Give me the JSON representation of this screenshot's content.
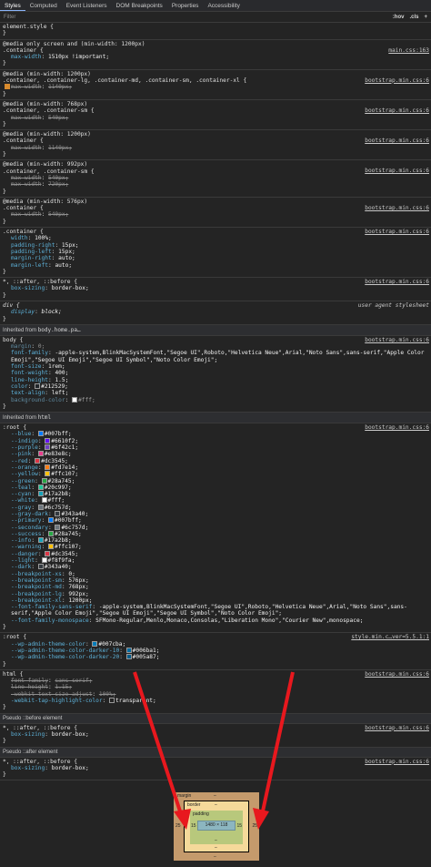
{
  "tabs": [
    "Styles",
    "Computed",
    "Event Listeners",
    "DOM Breakpoints",
    "Properties",
    "Accessibility"
  ],
  "filter": {
    "placeholder": "Filter",
    "hov": ":hov",
    "cls": ".cls",
    "add": "+"
  },
  "rules": [
    {
      "selector": "element.style {",
      "close": "}"
    },
    {
      "media": "@media only screen and (min-width: 1200px)",
      "selector": ".container {",
      "source": "main.css:163",
      "decls": [
        {
          "n": "max-width",
          "v": "1510px !important;"
        }
      ],
      "close": "}"
    },
    {
      "media": "@media (min-width: 1200px)",
      "selector": ".container, .container-lg, .container-md, .container-sm, .container-xl {",
      "source": "bootstrap.min.css:6",
      "decls": [
        {
          "n": "max-width",
          "v": "1140px;",
          "strike": true,
          "checked": true
        }
      ],
      "close": "}"
    },
    {
      "media": "@media (min-width: 768px)",
      "selector": ".container, .container-sm {",
      "source": "bootstrap.min.css:6",
      "decls": [
        {
          "n": "max-width",
          "v": "540px;",
          "strike": true
        }
      ],
      "close": "}"
    },
    {
      "media": "@media (min-width: 1200px)",
      "selector": ".container {",
      "source": "bootstrap.min.css:6",
      "decls": [
        {
          "n": "max-width",
          "v": "1140px;",
          "strike": true
        }
      ],
      "close": "}"
    },
    {
      "media": "@media (min-width: 992px)",
      "selector": ".container, .container-sm {",
      "source": "bootstrap.min.css:6",
      "decls": [
        {
          "n": "max-width",
          "v": "540px;",
          "strike": true
        },
        {
          "n": "max-width",
          "v": "720px;",
          "strike": true
        }
      ],
      "close": "}"
    },
    {
      "media": "@media (min-width: 576px)",
      "selector": ".container {",
      "source": "bootstrap.min.css:6",
      "decls": [
        {
          "n": "max-width",
          "v": "540px;",
          "strike": true
        }
      ],
      "close": "}"
    },
    {
      "selector": ".container {",
      "source": "bootstrap.min.css:6",
      "decls": [
        {
          "n": "width",
          "v": "100%;"
        },
        {
          "n": "padding-right",
          "v": "15px;"
        },
        {
          "n": "padding-left",
          "v": "15px;"
        },
        {
          "n": "margin-right",
          "v": "auto;"
        },
        {
          "n": "margin-left",
          "v": "auto;"
        }
      ],
      "close": "}"
    },
    {
      "selector": "*, ::after, ::before {",
      "source": "bootstrap.min.css:6",
      "decls": [
        {
          "n": "box-sizing",
          "v": "border-box;"
        }
      ],
      "close": "}"
    },
    {
      "selector": "div {",
      "uas": "user agent stylesheet",
      "italic": true,
      "decls": [
        {
          "n": "display",
          "v": "block;"
        }
      ],
      "close": "}"
    }
  ],
  "inherited_body": {
    "label": "Inherited from ",
    "ref": "body.home.pa…"
  },
  "body_rule": {
    "selector": "body {",
    "source": "bootstrap.min.css:6",
    "decls": [
      {
        "n": "margin",
        "v": "0;",
        "dim": true
      },
      {
        "n": "font-family",
        "v": "-apple-system,BlinkMacSystemFont,\"Segoe UI\",Roboto,\"Helvetica Neue\",Arial,\"Noto Sans\",sans-serif,\"Apple Color Emoji\",\"Segoe UI Emoji\",\"Segoe UI Symbol\",\"Noto Color Emoji\";"
      },
      {
        "n": "font-size",
        "v": "1rem;"
      },
      {
        "n": "font-weight",
        "v": "400;"
      },
      {
        "n": "line-height",
        "v": "1.5;"
      },
      {
        "n": "color",
        "v": "#212529;",
        "sw": "#212529"
      },
      {
        "n": "text-align",
        "v": "left;"
      },
      {
        "n": "background-color",
        "v": "#fff;",
        "sw": "#ffffff",
        "dim": true
      }
    ],
    "close": "}"
  },
  "inherited_html": {
    "label": "Inherited from ",
    "ref": "html"
  },
  "root_rule": {
    "selector": ":root {",
    "source": "bootstrap.min.css:6",
    "decls": [
      {
        "n": "--blue",
        "v": "#007bff;",
        "sw": "#007bff"
      },
      {
        "n": "--indigo",
        "v": "#6610f2;",
        "sw": "#6610f2"
      },
      {
        "n": "--purple",
        "v": "#6f42c1;",
        "sw": "#6f42c1"
      },
      {
        "n": "--pink",
        "v": "#e83e8c;",
        "sw": "#e83e8c"
      },
      {
        "n": "--red",
        "v": "#dc3545;",
        "sw": "#dc3545"
      },
      {
        "n": "--orange",
        "v": "#fd7e14;",
        "sw": "#fd7e14"
      },
      {
        "n": "--yellow",
        "v": "#ffc107;",
        "sw": "#ffc107"
      },
      {
        "n": "--green",
        "v": "#28a745;",
        "sw": "#28a745"
      },
      {
        "n": "--teal",
        "v": "#20c997;",
        "sw": "#20c997"
      },
      {
        "n": "--cyan",
        "v": "#17a2b8;",
        "sw": "#17a2b8"
      },
      {
        "n": "--white",
        "v": "#fff;",
        "sw": "#ffffff"
      },
      {
        "n": "--gray",
        "v": "#6c757d;",
        "sw": "#6c757d"
      },
      {
        "n": "--gray-dark",
        "v": "#343a40;",
        "sw": "#343a40"
      },
      {
        "n": "--primary",
        "v": "#007bff;",
        "sw": "#007bff"
      },
      {
        "n": "--secondary",
        "v": "#6c757d;",
        "sw": "#6c757d"
      },
      {
        "n": "--success",
        "v": "#28a745;",
        "sw": "#28a745"
      },
      {
        "n": "--info",
        "v": "#17a2b8;",
        "sw": "#17a2b8"
      },
      {
        "n": "--warning",
        "v": "#ffc107;",
        "sw": "#ffc107"
      },
      {
        "n": "--danger",
        "v": "#dc3545;",
        "sw": "#dc3545"
      },
      {
        "n": "--light",
        "v": "#f8f9fa;",
        "sw": "#f8f9fa"
      },
      {
        "n": "--dark",
        "v": "#343a40;",
        "sw": "#343a40"
      },
      {
        "n": "--breakpoint-xs",
        "v": "0;"
      },
      {
        "n": "--breakpoint-sm",
        "v": "576px;"
      },
      {
        "n": "--breakpoint-md",
        "v": "768px;"
      },
      {
        "n": "--breakpoint-lg",
        "v": "992px;"
      },
      {
        "n": "--breakpoint-xl",
        "v": "1200px;"
      },
      {
        "n": "--font-family-sans-serif",
        "v": "-apple-system,BlinkMacSystemFont,\"Segoe UI\",Roboto,\"Helvetica Neue\",Arial,\"Noto Sans\",sans-serif,\"Apple Color Emoji\",\"Segoe UI Emoji\",\"Segoe UI Symbol\",\"Noto Color Emoji\";"
      },
      {
        "n": "--font-family-monospace",
        "v": "SFMono-Regular,Menlo,Monaco,Consolas,\"Liberation Mono\",\"Courier New\",monospace;"
      }
    ],
    "close": "}"
  },
  "root2_rule": {
    "selector": ":root {",
    "source": "style.min.c…ver=5.5.1:1",
    "decls": [
      {
        "n": "--wp-admin-theme-color",
        "v": "#007cba;",
        "sw": "#007cba"
      },
      {
        "n": "--wp-admin-theme-color-darker-10",
        "v": "#006ba1;",
        "sw": "#006ba1"
      },
      {
        "n": "--wp-admin-theme-color-darker-20",
        "v": "#005a87;",
        "sw": "#005a87"
      }
    ],
    "close": "}"
  },
  "html_rule": {
    "selector": "html {",
    "source": "bootstrap.min.css:6",
    "decls": [
      {
        "n": "font-family",
        "v": "sans-serif;",
        "strike": true
      },
      {
        "n": "line-height",
        "v": "1.15;",
        "strike": true
      },
      {
        "n": "-webkit-text-size-adjust",
        "v": "100%;",
        "strike": true
      },
      {
        "n": "-webkit-tap-highlight-color",
        "v": "transparent;",
        "sw": "transparent"
      }
    ],
    "close": "}"
  },
  "pseudo_before": {
    "label": "Pseudo ::before element"
  },
  "before_rule": {
    "selector": "*, ::after, ::before {",
    "source": "bootstrap.min.css:6",
    "decls": [
      {
        "n": "box-sizing",
        "v": "border-box;"
      }
    ],
    "close": "}"
  },
  "pseudo_after": {
    "label": "Pseudo ::after element"
  },
  "after_rule": {
    "selector": "*, ::after, ::before {",
    "source": "bootstrap.min.css:6",
    "decls": [
      {
        "n": "box-sizing",
        "v": "border-box;"
      }
    ],
    "close": "}"
  },
  "box_model": {
    "margin_label": "margin",
    "margin_top": "–",
    "margin_bottom": "–",
    "margin_left": "25",
    "margin_right": "25",
    "border_label": "border",
    "border_top": "–",
    "border_bottom": "–",
    "padding_label": "padding",
    "padding_top": "–",
    "padding_bottom": "–",
    "padding_left": "15",
    "padding_right": "15",
    "content": "1480 × 118"
  },
  "colors": {
    "arrow": "#e8181e"
  }
}
